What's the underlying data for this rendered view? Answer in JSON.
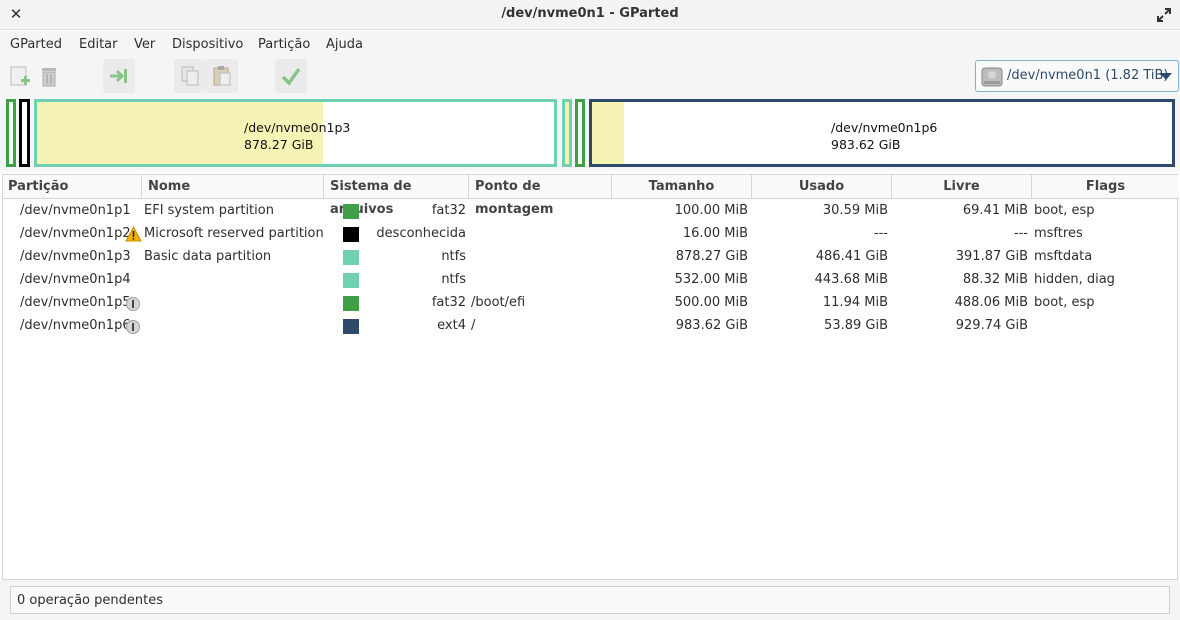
{
  "window": {
    "title": "/dev/nvme0n1 - GParted"
  },
  "menu": [
    "GParted",
    "Editar",
    "Ver",
    "Dispositivo",
    "Partição",
    "Ajuda"
  ],
  "toolbar": {
    "buttons": [
      "new-partition-icon",
      "delete-icon",
      "resize-move-icon",
      "copy-icon",
      "paste-icon",
      "apply-icon"
    ]
  },
  "device": {
    "label": "/dev/nvme0n1 (1.82 TiB)"
  },
  "diskmap": {
    "p3": {
      "name": "/dev/nvme0n1p3",
      "size": "878.27 GiB",
      "used_fraction": 0.554
    },
    "p6": {
      "name": "/dev/nvme0n1p6",
      "size": "983.62 GiB",
      "used_fraction": 0.055
    }
  },
  "table": {
    "headers": [
      "Partição",
      "Nome",
      "Sistema de arquivos",
      "Ponto de montagem",
      "Tamanho",
      "Usado",
      "Livre",
      "Flags"
    ],
    "rows": [
      {
        "partition": "/dev/nvme0n1p1",
        "name": "EFI system partition",
        "fs": "fat32",
        "color": "#3f9f46",
        "mount": "",
        "size": "100.00 MiB",
        "used": "30.59 MiB",
        "free": "69.41 MiB",
        "flags": "boot, esp",
        "badge": ""
      },
      {
        "partition": "/dev/nvme0n1p2",
        "name": "Microsoft reserved partition",
        "fs": "desconhecida",
        "color": "#000000",
        "mount": "",
        "size": "16.00 MiB",
        "used": "---",
        "free": "---",
        "flags": "msftres",
        "badge": "warning-icon"
      },
      {
        "partition": "/dev/nvme0n1p3",
        "name": "Basic data partition",
        "fs": "ntfs",
        "color": "#6fd0b2",
        "mount": "",
        "size": "878.27 GiB",
        "used": "486.41 GiB",
        "free": "391.87 GiB",
        "flags": "msftdata",
        "badge": ""
      },
      {
        "partition": "/dev/nvme0n1p4",
        "name": "",
        "fs": "ntfs",
        "color": "#6fd0b2",
        "mount": "",
        "size": "532.00 MiB",
        "used": "443.68 MiB",
        "free": "88.32 MiB",
        "flags": "hidden, diag",
        "badge": ""
      },
      {
        "partition": "/dev/nvme0n1p5",
        "name": "",
        "fs": "fat32",
        "color": "#3f9f46",
        "mount": "/boot/efi",
        "size": "500.00 MiB",
        "used": "11.94 MiB",
        "free": "488.06 MiB",
        "flags": "boot, esp",
        "badge": "lock-icon"
      },
      {
        "partition": "/dev/nvme0n1p6",
        "name": "",
        "fs": "ext4",
        "color": "#2d4a6b",
        "mount": "/",
        "size": "983.62 GiB",
        "used": "53.89 GiB",
        "free": "929.74 GiB",
        "flags": "",
        "badge": "lock-icon"
      }
    ]
  },
  "status": {
    "text": "0 operação pendentes"
  }
}
